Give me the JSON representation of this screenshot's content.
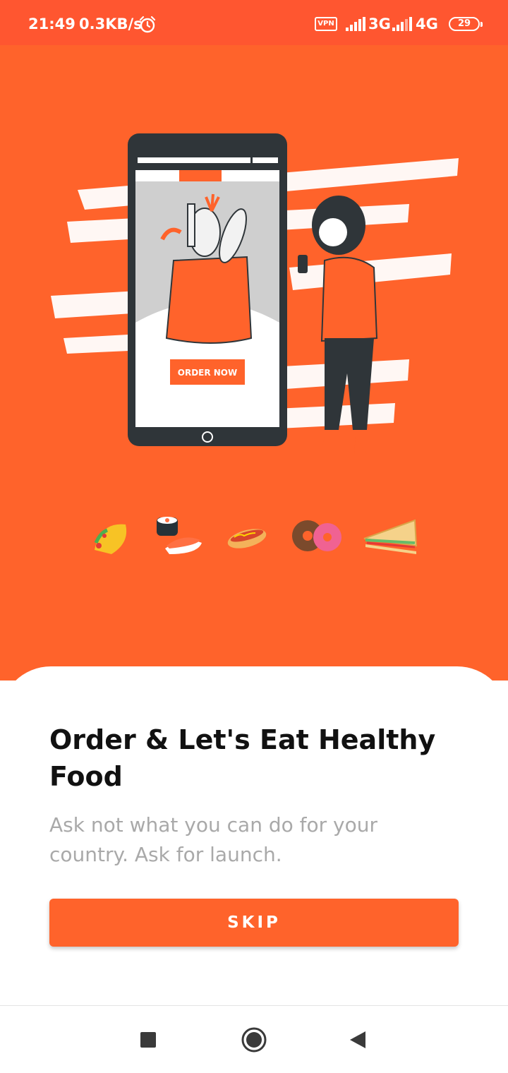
{
  "status_bar": {
    "time": "21:49",
    "net_speed": "0.3KB/s",
    "vpn_label": "VPN",
    "net1": "3G",
    "net2": "4G",
    "battery": "29",
    "icons": [
      "alarm-icon",
      "signal-icon",
      "signal-icon",
      "battery-icon"
    ]
  },
  "hero": {
    "illustration_button_text": "ORDER NOW",
    "food_icons": [
      "taco-icon",
      "sushi-icon",
      "hotdog-icon",
      "donut-icon",
      "sandwich-icon"
    ]
  },
  "onboarding": {
    "title": "Order & Let's Eat Healthy Food",
    "subtitle": "Ask not what you can do for your country. Ask for launch.",
    "skip_label": "SKIP"
  },
  "nav_bar": {
    "icons": [
      "recents-icon",
      "home-icon",
      "back-icon"
    ]
  },
  "colors": {
    "status_bar": "#ff5630",
    "brand_orange": "#ff632b",
    "title_text": "#111111",
    "subtitle_text": "#a9a9a9"
  }
}
